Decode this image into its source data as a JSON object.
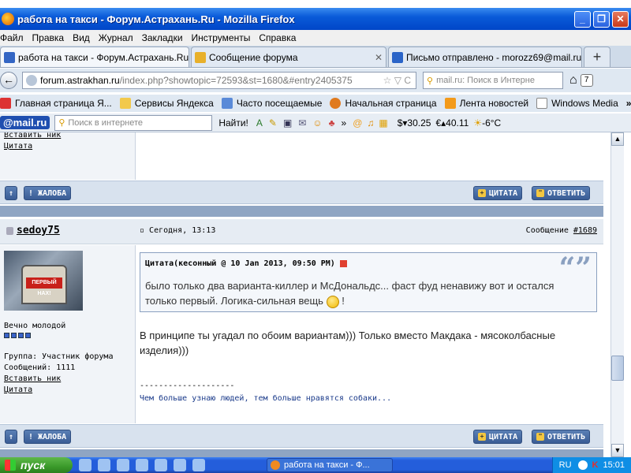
{
  "window": {
    "title": "работа на такси - Форум.Астрахань.Ru - Mozilla Firefox",
    "min_label": "_",
    "max_label": "❐",
    "close_label": "✕"
  },
  "menu": [
    "Файл",
    "Правка",
    "Вид",
    "Журнал",
    "Закладки",
    "Инструменты",
    "Справка"
  ],
  "tabs": [
    {
      "label": "работа на такси - Форум.Астрахань.Ru",
      "color": "#3466c4"
    },
    {
      "label": "Сообщение форума",
      "color": "#e8b02a"
    },
    {
      "label": "Письмо отправлено - morozz69@mail.ru...",
      "color": "#2a64c8"
    }
  ],
  "newtab_label": "+",
  "tab_close": "✕",
  "nav": {
    "back": "←",
    "url_host": "forum.astrakhan.ru",
    "url_path": "/index.php?showtopic=72593&st=1680&#entry2405375",
    "url_controls": "☆ ▽ C",
    "search_placeholder": "mail.ru: Поиск в Интерне",
    "home": "⌂",
    "badge": "7"
  },
  "bookmarks": [
    {
      "label": "Главная страница Я...",
      "color": "#d33"
    },
    {
      "label": "Сервисы Яндекса",
      "color": "#f2c94c"
    },
    {
      "label": "Часто посещаемые",
      "color": "#5a8ad8"
    },
    {
      "label": "Начальная страница",
      "color": "#e07a1e"
    },
    {
      "label": "Лента новостей",
      "color": "#f39a1a"
    },
    {
      "label": "Windows Media",
      "color": "#ffffff"
    }
  ],
  "bookmarks_more": "»",
  "mailbar": {
    "logo": "@mail.ru",
    "search_placeholder": "Поиск в интернете",
    "find_label": "Найти!",
    "usd": "$▾30.25",
    "eur": "€▴40.11",
    "weather": "-6°C"
  },
  "prev_post": {
    "insert_nick": "Вставить ник",
    "quote": "Цитата"
  },
  "actions": {
    "up": "↑",
    "complaint": "! ЖАЛОБА",
    "quote_btn": "ЦИТАТА",
    "reply_btn": "ОТВЕТИТЬ"
  },
  "post": {
    "username": "sedoy75",
    "date": "Сегодня, 13:13",
    "msg_prefix": "Сообщение",
    "msg_number": "#1689",
    "avatar_sign": "ПЕРВЫЙ НАХ!",
    "user_title": "Вечно молодой",
    "group": "Группа: Участник форума",
    "messages": "Сообщений: 1111",
    "insert_nick": "Вставить ник",
    "quote_link": "Цитата",
    "quote_header": "Цитата(кесонный @ 10 Jan 2013, 09:50 PM)",
    "quote_text": "было только два варианта-киллер и МсДональдс... фаст фуд ненавижу вот и остался только первый. Логика-сильная вещь",
    "quote_tail": "!",
    "body": "В принципе ты угадал по обоим вариантам))) Только вместо Макдака - мясоколбасные изделия)))",
    "sig_line": "--------------------",
    "signature": "Чем больше узнаю людей, тем больше нравятся собаки..."
  },
  "taskbar": {
    "start": "пуск",
    "task": "работа на такси - Ф...",
    "lang": "RU",
    "time": "15:01"
  }
}
